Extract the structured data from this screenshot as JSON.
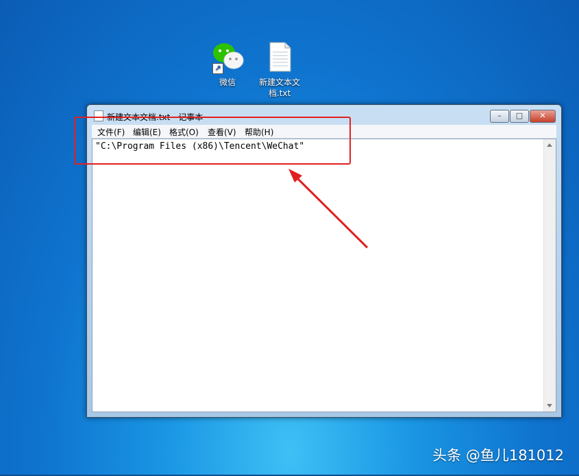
{
  "desktop": {
    "icons": [
      {
        "label": "微信"
      },
      {
        "label": "新建文本文\n档.txt"
      }
    ]
  },
  "window": {
    "title": "新建文本文档.txt - 记事本",
    "buttons": {
      "minimize": "–",
      "maximize": "□",
      "close": "✕"
    },
    "menu": [
      "文件(F)",
      "编辑(E)",
      "格式(O)",
      "查看(V)",
      "帮助(H)"
    ],
    "content": "\"C:\\Program Files (x86)\\Tencent\\WeChat\""
  },
  "annotation": {
    "color": "#e02020"
  },
  "watermark": "头条 @鱼儿181012"
}
